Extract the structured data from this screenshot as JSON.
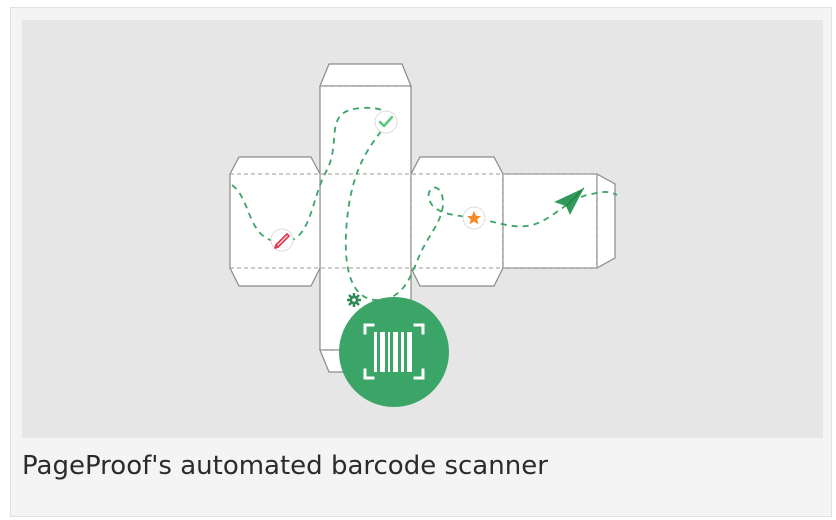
{
  "caption": {
    "text": "PageProof's automated barcode scanner"
  },
  "illustration": {
    "icons": [
      "check-icon",
      "star-icon",
      "pencil-icon",
      "gear-icon",
      "paper-plane-icon",
      "barcode-icon"
    ],
    "colors": {
      "background": "#e6e6e6",
      "panel": "#ffffff",
      "path": "#3aa566",
      "badge": "#3aa566",
      "star": "#f28c28",
      "pencil": "#e23b4e",
      "check": "#5cc77f"
    }
  }
}
